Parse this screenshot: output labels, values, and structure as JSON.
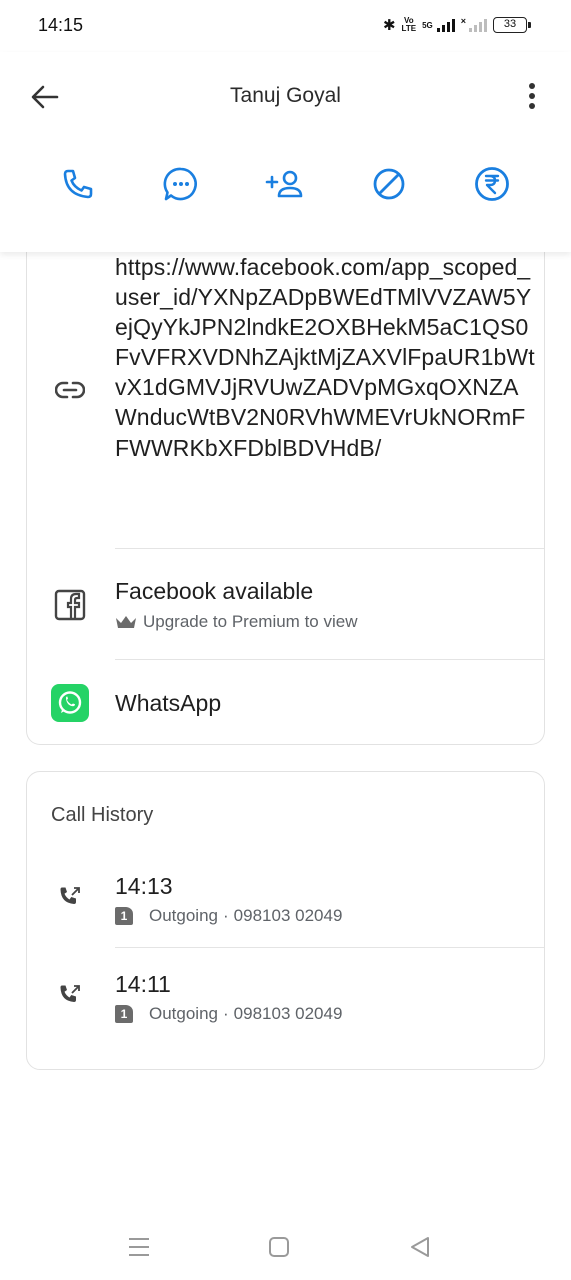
{
  "status_bar": {
    "time": "14:15",
    "volte_top": "Vo",
    "volte_bottom": "LTE",
    "network": "5G",
    "battery": "33"
  },
  "header": {
    "title": "Tanuj Goyal"
  },
  "actions": [
    {
      "icon": "phone-icon"
    },
    {
      "icon": "message-icon"
    },
    {
      "icon": "add-contact-icon"
    },
    {
      "icon": "block-icon"
    },
    {
      "icon": "rupee-icon"
    }
  ],
  "links": {
    "url": "https://www.facebook.com/app_scoped_user_id/YXNpZADpBWEdTMlVVZAW5YejQyYkJPN2lndkE2OXBHekM5aC1QS0FvVFRXVDNhZAjktMjZAXVlFpaUR1bWtvX1dGMVJjRVUwZADVpMGxqOXNZAWnducWtBV2N0RVhWMEVrUkNORmFFWWRKbXFDblBDVHdB/",
    "facebook": {
      "title": "Facebook available",
      "subtitle": "Upgrade to Premium to view"
    },
    "whatsapp": {
      "title": "WhatsApp"
    }
  },
  "call_history": {
    "title": "Call History",
    "calls": [
      {
        "time": "14:13",
        "sim": "1",
        "type": "Outgoing",
        "separator": "·",
        "number": "098103 02049"
      },
      {
        "time": "14:11",
        "sim": "1",
        "type": "Outgoing",
        "separator": "·",
        "number": "098103 02049"
      }
    ]
  },
  "colors": {
    "accent": "#1a7fe0",
    "whatsapp": "#25d366",
    "text_primary": "#1f1f1f",
    "text_secondary": "#5f6368"
  }
}
